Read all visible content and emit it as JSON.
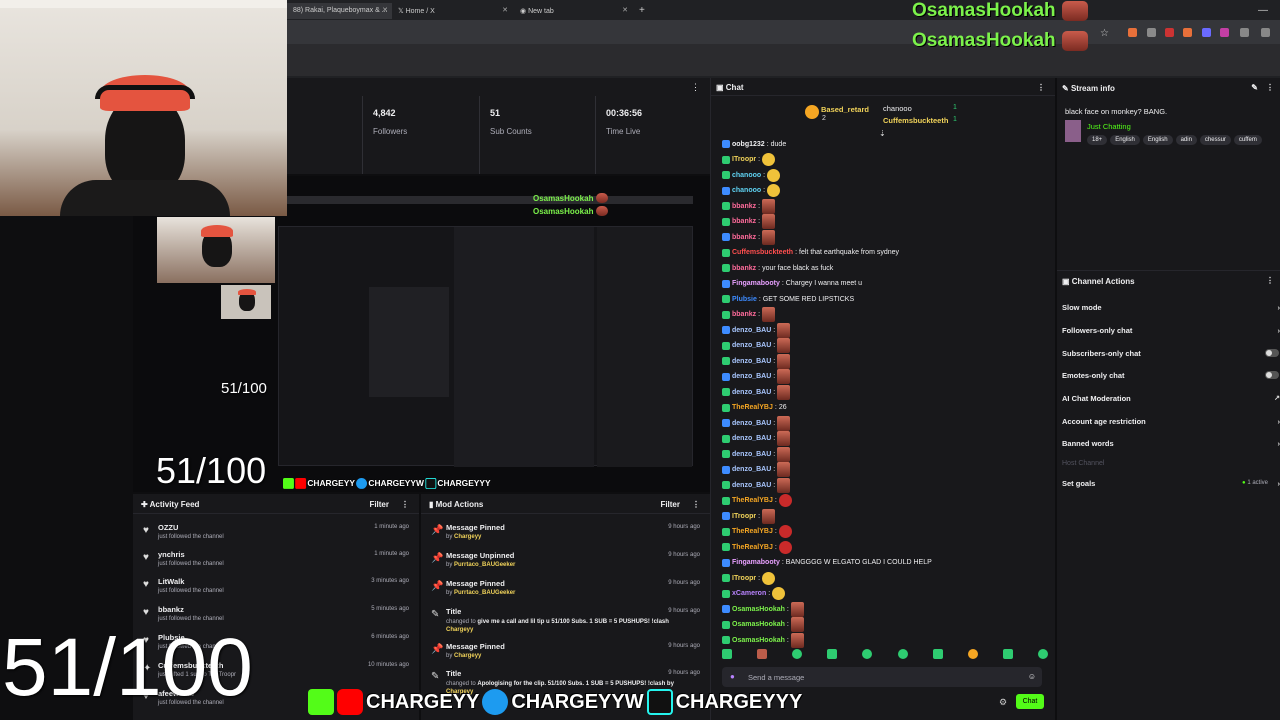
{
  "browser": {
    "tabs": [
      {
        "title": "88) Rakai, Plaqueboymax & ..."
      },
      {
        "title": "Home / X"
      },
      {
        "title": "New tab"
      }
    ],
    "overlay_names": [
      "OsamasHookah",
      "OsamasHookah"
    ]
  },
  "stats": [
    {
      "value": "4,842",
      "label": "Followers"
    },
    {
      "value": "51",
      "label": "Sub Counts"
    },
    {
      "value": "00:36:56",
      "label": "Time Live"
    }
  ],
  "preview": {
    "sub_counter": "51/100",
    "names": [
      "OsamasHookah",
      "OsamasHookah"
    ]
  },
  "activity_feed": {
    "title": "Activity Feed",
    "filter_label": "Filter",
    "items": [
      {
        "name": "OZZU",
        "desc": "just followed the channel",
        "time": "1 minute ago"
      },
      {
        "name": "ynchris",
        "desc": "just followed the channel",
        "time": "1 minute ago"
      },
      {
        "name": "LitWalk",
        "desc": "just followed the channel",
        "time": "3 minutes ago"
      },
      {
        "name": "bbankz",
        "desc": "just followed the channel",
        "time": "5 minutes ago"
      },
      {
        "name": "Plubsie",
        "desc": "just followed the channel",
        "time": "6 minutes ago"
      },
      {
        "name": "Cuffemsbuckteeth",
        "desc": "just gifted 1 sub to TheTroopr",
        "time": "10 minutes ago"
      },
      {
        "name": "afeewsmb",
        "desc": "just followed the channel",
        "time": ""
      }
    ]
  },
  "mod_actions": {
    "title": "Mod Actions",
    "filter_label": "Filter",
    "items": [
      {
        "action": "Message Pinned",
        "by": "by ",
        "user": "Chargeyy",
        "time": "9 hours ago",
        "icon": "pin-icon"
      },
      {
        "action": "Message Unpinned",
        "by": "by ",
        "user": "Purrtaco_BAUGeeker",
        "time": "9 hours ago",
        "icon": "pin-icon"
      },
      {
        "action": "Message Pinned",
        "by": "by ",
        "user": "Purrtaco_BAUGeeker",
        "time": "9 hours ago",
        "icon": "pin-icon"
      },
      {
        "action": "Title",
        "by": "changed to ",
        "detail": "give me a call and lil tip u 51/100 Subs. 1 SUB = 5 PUSHUPS! !clash",
        "user": "Chargeyy",
        "time": "9 hours ago",
        "icon": "title-icon"
      },
      {
        "action": "Message Pinned",
        "by": "by ",
        "user": "Chargeyy",
        "time": "9 hours ago",
        "icon": "pin-icon"
      },
      {
        "action": "Title",
        "by": "changed to ",
        "detail": "Apologising for the clip. 51/100 Subs. 1 SUB = 5 PUSHUPS! !clash by",
        "user": "Chargeyy",
        "time": "9 hours ago",
        "icon": "title-icon"
      }
    ]
  },
  "chat": {
    "title": "Chat",
    "leaderboard": [
      {
        "name": "Based_retard",
        "count": "2"
      },
      {
        "name": "chanooo",
        "count": "1"
      },
      {
        "name": "Cuffemsbuckteeth",
        "count": "1"
      }
    ],
    "messages": [
      {
        "user": "oobg1232",
        "text": "dude",
        "color": "#efeff1"
      },
      {
        "user": "ITroopr",
        "text": "",
        "color": "#f1d35a",
        "emote": "emo"
      },
      {
        "user": "chanooo",
        "text": "",
        "color": "#5fd3f3",
        "emote": "emo"
      },
      {
        "user": "chanooo",
        "text": "",
        "color": "#5fd3f3",
        "emote": "emo"
      },
      {
        "user": "bbankz",
        "text": "",
        "color": "#ff6b9b",
        "emote": "emo r"
      },
      {
        "user": "bbankz",
        "text": "",
        "color": "#ff6b9b",
        "emote": "emo r"
      },
      {
        "user": "bbankz",
        "text": "",
        "color": "#ff6b9b",
        "emote": "emo r"
      },
      {
        "user": "Cuffemsbuckteeth",
        "text": "felt that earthquake from sydney",
        "color": "#ff4f4f"
      },
      {
        "user": "bbankz",
        "text": "your face black as fuck",
        "color": "#ff6b9b"
      },
      {
        "user": "Fingamabooty",
        "text": "Chargey I wanna meet u",
        "color": "#e8a0ff"
      },
      {
        "user": "Plubsie",
        "text": "GET SOME RED LIPSTICKS",
        "color": "#3d8bff"
      },
      {
        "user": "bbankz",
        "text": "",
        "color": "#ff6b9b",
        "emote": "emo r"
      },
      {
        "user": "denzo_BAU",
        "text": "",
        "color": "#a9c7ff",
        "emote": "emo r"
      },
      {
        "user": "denzo_BAU",
        "text": "",
        "color": "#a9c7ff",
        "emote": "emo r"
      },
      {
        "user": "denzo_BAU",
        "text": "",
        "color": "#a9c7ff",
        "emote": "emo r"
      },
      {
        "user": "denzo_BAU",
        "text": "",
        "color": "#a9c7ff",
        "emote": "emo r"
      },
      {
        "user": "denzo_BAU",
        "text": "",
        "color": "#a9c7ff",
        "emote": "emo r"
      },
      {
        "user": "TheRealYBJ",
        "text": "26",
        "color": "#f5a623"
      },
      {
        "user": "denzo_BAU",
        "text": "",
        "color": "#a9c7ff",
        "emote": "emo r"
      },
      {
        "user": "denzo_BAU",
        "text": "",
        "color": "#a9c7ff",
        "emote": "emo r"
      },
      {
        "user": "denzo_BAU",
        "text": "",
        "color": "#a9c7ff",
        "emote": "emo r"
      },
      {
        "user": "denzo_BAU",
        "text": "",
        "color": "#a9c7ff",
        "emote": "emo r"
      },
      {
        "user": "denzo_BAU",
        "text": "",
        "color": "#a9c7ff",
        "emote": "emo r"
      },
      {
        "user": "TheRealYBJ",
        "text": "",
        "color": "#f5a623",
        "emote": "emo m"
      },
      {
        "user": "ITroopr",
        "text": "",
        "color": "#f1d35a",
        "emote": "emo r"
      },
      {
        "user": "TheRealYBJ",
        "text": "",
        "color": "#f5a623",
        "emote": "emo m"
      },
      {
        "user": "TheRealYBJ",
        "text": "",
        "color": "#f5a623",
        "emote": "emo m"
      },
      {
        "user": "Fingamabooty",
        "text": "BANGGGG W ELGATO GLAD I COULD HELP",
        "color": "#e8a0ff"
      },
      {
        "user": "ITroopr",
        "text": "",
        "color": "#f1d35a",
        "emote": "emo"
      },
      {
        "user": "xCameron",
        "text": "",
        "color": "#b983ff",
        "emote": "emo"
      },
      {
        "user": "OsamasHookah",
        "text": "",
        "color": "#7cf24b",
        "emote": "emo r"
      },
      {
        "user": "OsamasHookah",
        "text": "",
        "color": "#7cf24b",
        "emote": "emo r"
      },
      {
        "user": "OsamasHookah",
        "text": "",
        "color": "#7cf24b",
        "emote": "emo r"
      }
    ],
    "input_placeholder": "Send a message",
    "send_label": "Chat"
  },
  "stream_info": {
    "title": "Stream info",
    "stream_title": "black face on monkey? BANG.",
    "category": "Just Chatting",
    "tags": [
      "18+",
      "English",
      "English",
      "adin",
      "chessur",
      "cuffem"
    ]
  },
  "channel_actions": {
    "title": "Channel Actions",
    "items": [
      {
        "label": "Slow mode",
        "control": "arrow"
      },
      {
        "label": "Followers-only chat",
        "control": "arrow"
      },
      {
        "label": "Subscribers-only chat",
        "control": "toggle"
      },
      {
        "label": "Emotes-only chat",
        "control": "toggle"
      },
      {
        "label": "AI Chat Moderation",
        "control": "external"
      },
      {
        "label": "Account age restriction",
        "control": "arrow"
      },
      {
        "label": "Banned words",
        "control": "arrow"
      },
      {
        "label": "Host Channel",
        "control": "none"
      },
      {
        "label": "Set goals",
        "control": "arrow",
        "status": "1 active"
      }
    ]
  },
  "overlay": {
    "sub_counter_small": "51/100",
    "sub_counter_medium": "51/100",
    "sub_counter_large": "51/100",
    "socials": [
      "CHARGEYY",
      "CHARGEYYW",
      "CHARGEYYY"
    ]
  }
}
